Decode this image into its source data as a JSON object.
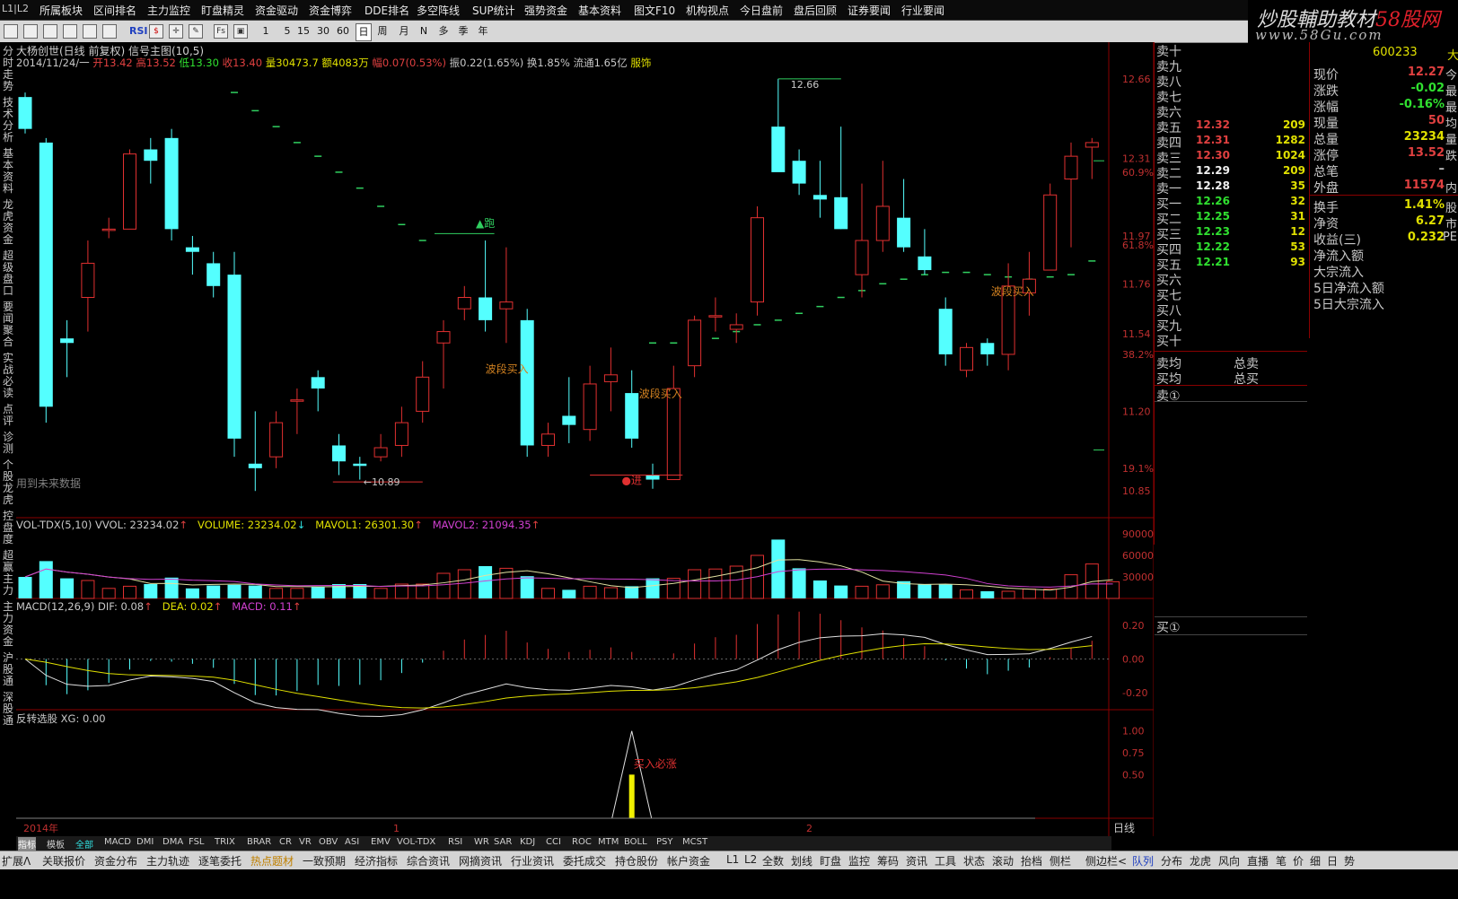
{
  "menu": {
    "l2": "L1|L2",
    "items": [
      "所属板块",
      "区间排名",
      "主力监控",
      "盯盘精灵",
      "资金驱动",
      "资金博弈",
      "DDE排名",
      "多空阵线",
      "SUP统计",
      "强势资金",
      "基本资料",
      "图文F10",
      "机构视点",
      "今日盘前",
      "盘后回顾",
      "证券要闻",
      "行业要闻"
    ]
  },
  "watermark": {
    "line1_a": "炒股輔助教材",
    "line1_b": "58股网",
    "line2": "www.58Gu.com"
  },
  "toolbar": {
    "items": [
      "RSI",
      "1",
      "5",
      "15",
      "30",
      "60",
      "日",
      "周",
      "月",
      "N",
      "多",
      "季",
      "年"
    ]
  },
  "left_tabs": [
    "分时走势",
    "技术分析",
    "基本资料",
    "龙虎资金",
    "超级盘口",
    "要闻聚合",
    "实战必读",
    "点评",
    "诊测",
    "个股龙虎",
    "控盘度",
    "超赢主力",
    "主力资金",
    "沪股通",
    "深股通"
  ],
  "chart_header": {
    "title": "大杨创世(日线 前复权) 信号主图(10,5)",
    "date": "2014/11/24/一",
    "open": "开13.42",
    "high": "高13.52",
    "low": "低13.30",
    "close": "收13.40",
    "vol": "量30473.7",
    "amount": "额4083万",
    "change": "幅0.07(0.53%)",
    "amp": "振0.22(1.65%)",
    "turnover": "换1.85%",
    "float": "流通1.65亿",
    "industry": "服饰"
  },
  "annotations": {
    "high": "12.66",
    "low": "10.89",
    "pao": "▲跑",
    "jin": "●进",
    "b1": "波段买入",
    "b2": "波段买入",
    "b3": "波段买入",
    "future": "用到未来数据",
    "buy_sure": "买入必涨"
  },
  "price_axis": {
    "labels": [
      "12.66",
      "12.31",
      "11.97",
      "11.76",
      "11.54",
      "11.20",
      "10.85"
    ],
    "pcts": [
      "60.9%",
      "61.8%",
      "38.2%",
      "19.1%"
    ]
  },
  "vol_header": {
    "name": "VOL-TDX(5,10)",
    "vvol": "VVOL: 23234.02",
    "volume": "VOLUME: 23234.02",
    "mavol1": "MAVOL1: 26301.30",
    "mavol2": "MAVOL2: 21094.35",
    "axis": [
      "90000",
      "60000",
      "30000"
    ]
  },
  "macd_header": {
    "name": "MACD(12,26,9)",
    "dif": "DIF: 0.08",
    "dea": "DEA: 0.02",
    "macd": "MACD: 0.11",
    "axis": [
      "0.20",
      "0.00",
      "-0.20"
    ]
  },
  "xg_header": {
    "name": "反转选股",
    "xg": "XG: 0.00",
    "axis": [
      "1.00",
      "0.75",
      "0.50"
    ]
  },
  "x_axis": {
    "year": "2014年",
    "m1": "1",
    "m2": "2",
    "period": "日线"
  },
  "chart_data": {
    "type": "candlestick",
    "ohlc": [
      [
        12.58,
        12.6,
        12.42,
        12.44
      ],
      [
        12.38,
        12.4,
        11.15,
        11.22
      ],
      [
        11.52,
        11.6,
        11.35,
        11.5
      ],
      [
        11.7,
        11.95,
        11.55,
        11.85
      ],
      [
        12.0,
        12.05,
        11.96,
        12.0
      ],
      [
        12.0,
        12.35,
        12.0,
        12.33
      ],
      [
        12.35,
        12.4,
        12.2,
        12.3
      ],
      [
        12.4,
        12.44,
        11.95,
        12.0
      ],
      [
        11.92,
        11.97,
        11.8,
        11.9
      ],
      [
        11.85,
        11.9,
        11.7,
        11.75
      ],
      [
        11.8,
        11.9,
        11.0,
        11.08
      ],
      [
        10.97,
        11.2,
        10.85,
        10.95
      ],
      [
        11.0,
        11.2,
        10.95,
        11.15
      ],
      [
        11.25,
        11.3,
        11.1,
        11.25
      ],
      [
        11.35,
        11.38,
        11.2,
        11.3
      ],
      [
        11.05,
        11.1,
        10.92,
        10.98
      ],
      [
        10.97,
        11.0,
        10.9,
        10.96
      ],
      [
        11.0,
        11.1,
        10.98,
        11.04
      ],
      [
        11.05,
        11.22,
        11.0,
        11.15
      ],
      [
        11.2,
        11.42,
        11.15,
        11.35
      ],
      [
        11.5,
        11.6,
        11.3,
        11.55
      ],
      [
        11.65,
        11.75,
        11.6,
        11.7
      ],
      [
        11.7,
        11.95,
        11.55,
        11.6
      ],
      [
        11.65,
        11.92,
        11.5,
        11.68
      ],
      [
        11.6,
        11.65,
        11.0,
        11.05
      ],
      [
        11.05,
        11.15,
        11.0,
        11.1
      ],
      [
        11.18,
        11.35,
        11.06,
        11.14
      ],
      [
        11.12,
        11.4,
        11.07,
        11.32
      ],
      [
        11.33,
        11.48,
        11.2,
        11.36
      ],
      [
        11.28,
        11.38,
        11.04,
        11.08
      ],
      [
        10.92,
        10.97,
        10.86,
        10.9
      ],
      [
        10.9,
        11.4,
        10.9,
        11.3
      ],
      [
        11.4,
        11.62,
        11.35,
        11.6
      ],
      [
        11.62,
        11.7,
        11.55,
        11.62
      ],
      [
        11.56,
        11.63,
        11.5,
        11.58
      ],
      [
        11.68,
        12.1,
        11.62,
        12.05
      ],
      [
        12.45,
        12.66,
        12.35,
        12.25
      ],
      [
        12.3,
        12.35,
        12.15,
        12.2
      ],
      [
        12.15,
        12.3,
        12.05,
        12.13
      ],
      [
        12.14,
        12.45,
        12.0,
        12.0
      ],
      [
        11.8,
        12.2,
        11.7,
        11.95
      ],
      [
        11.95,
        12.3,
        11.9,
        12.1
      ],
      [
        12.05,
        12.22,
        11.9,
        11.92
      ],
      [
        11.88,
        12.0,
        11.8,
        11.82
      ],
      [
        11.65,
        11.7,
        11.4,
        11.45
      ],
      [
        11.38,
        11.5,
        11.35,
        11.48
      ],
      [
        11.5,
        11.52,
        11.4,
        11.45
      ],
      [
        11.45,
        11.85,
        11.38,
        11.75
      ],
      [
        11.72,
        11.9,
        11.62,
        11.78
      ],
      [
        11.82,
        12.2,
        11.82,
        12.15
      ],
      [
        12.22,
        12.38,
        11.92,
        12.32
      ],
      [
        12.36,
        12.4,
        12.22,
        12.38
      ]
    ],
    "volume": [
      30000,
      52000,
      28000,
      25000,
      14000,
      17000,
      20000,
      29000,
      14000,
      18000,
      19000,
      18000,
      14000,
      14000,
      16000,
      20000,
      20000,
      14000,
      20000,
      20000,
      35000,
      40000,
      45000,
      42000,
      31000,
      14000,
      12000,
      17000,
      15000,
      17000,
      28000,
      28000,
      40000,
      41000,
      45000,
      60000,
      82000,
      42000,
      25000,
      18000,
      17000,
      19000,
      24000,
      20000,
      20000,
      12000,
      10000,
      10000,
      13000,
      13000,
      33000,
      48000,
      23234
    ],
    "mavol1_last": 26301.3,
    "mavol2_last": 21094.35
  },
  "orderbook": {
    "sell": [
      {
        "lbl": "卖十",
        "p": "",
        "v": ""
      },
      {
        "lbl": "卖九",
        "p": "",
        "v": ""
      },
      {
        "lbl": "卖八",
        "p": "",
        "v": ""
      },
      {
        "lbl": "卖七",
        "p": "",
        "v": ""
      },
      {
        "lbl": "卖六",
        "p": "",
        "v": ""
      },
      {
        "lbl": "卖五",
        "p": "12.32",
        "v": "209"
      },
      {
        "lbl": "卖四",
        "p": "12.31",
        "v": "1282"
      },
      {
        "lbl": "卖三",
        "p": "12.30",
        "v": "1024"
      },
      {
        "lbl": "卖二",
        "p": "12.29",
        "v": "209"
      },
      {
        "lbl": "卖一",
        "p": "12.28",
        "v": "35"
      }
    ],
    "buy": [
      {
        "lbl": "买一",
        "p": "12.26",
        "v": "32"
      },
      {
        "lbl": "买二",
        "p": "12.25",
        "v": "31"
      },
      {
        "lbl": "买三",
        "p": "12.23",
        "v": "12"
      },
      {
        "lbl": "买四",
        "p": "12.22",
        "v": "53"
      },
      {
        "lbl": "买五",
        "p": "12.21",
        "v": "93"
      },
      {
        "lbl": "买六",
        "p": "",
        "v": ""
      },
      {
        "lbl": "买七",
        "p": "",
        "v": ""
      },
      {
        "lbl": "买八",
        "p": "",
        "v": ""
      },
      {
        "lbl": "买九",
        "p": "",
        "v": ""
      },
      {
        "lbl": "买十",
        "p": "",
        "v": ""
      }
    ],
    "sell_avg": "卖均",
    "buy_avg": "买均",
    "total_sell": "总卖",
    "total_buy": "总买",
    "sell1_queue": "卖①",
    "buy1_queue": "买①"
  },
  "quote": {
    "code": "600233",
    "code_suffix": "大",
    "rows": [
      {
        "lbl": "现价",
        "val": "12.27",
        "suf": "今",
        "col": "#e04040"
      },
      {
        "lbl": "涨跌",
        "val": "-0.02",
        "suf": "最",
        "col": "#30e030"
      },
      {
        "lbl": "涨幅",
        "val": "-0.16%",
        "suf": "最",
        "col": "#30e030"
      },
      {
        "lbl": "现量",
        "val": "50",
        "suf": "均",
        "col": "#e04040"
      },
      {
        "lbl": "总量",
        "val": "23234",
        "suf": "量",
        "col": "#e0e000"
      },
      {
        "lbl": "涨停",
        "val": "13.52",
        "suf": "跌",
        "col": "#e04040"
      },
      {
        "lbl": "总笔",
        "val": "–",
        "suf": "",
        "col": "#c8c8c8"
      },
      {
        "lbl": "外盘",
        "val": "11574",
        "suf": "内",
        "col": "#e04040"
      },
      {
        "lbl": "换手",
        "val": "1.41%",
        "suf": "股",
        "col": "#e0e000"
      },
      {
        "lbl": "净资",
        "val": "6.27",
        "suf": "市",
        "col": "#e0e000"
      },
      {
        "lbl": "收益(三)",
        "val": "0.232",
        "suf": "PE",
        "col": "#e0e000"
      },
      {
        "lbl": "净流入额",
        "val": "",
        "suf": "",
        "col": "#e04040"
      },
      {
        "lbl": "大宗流入",
        "val": "",
        "suf": "",
        "col": "#e04040"
      },
      {
        "lbl": "5日净流入额",
        "val": "",
        "suf": "",
        "col": "#e04040"
      },
      {
        "lbl": "5日大宗流入",
        "val": "",
        "suf": "",
        "col": "#e04040"
      }
    ]
  },
  "indicator_tabs": [
    "指标",
    "模板",
    "全部",
    "MACD",
    "DMI",
    "DMA",
    "FSL",
    "TRIX",
    "BRAR",
    "CR",
    "VR",
    "OBV",
    "ASI",
    "EMV",
    "VOL-TDX",
    "RSI",
    "WR",
    "SAR",
    "KDJ",
    "CCI",
    "ROC",
    "MTM",
    "BOLL",
    "PSY",
    "MCST"
  ],
  "status_bar": [
    "扩展Λ",
    "关联报价",
    "资金分布",
    "主力轨迹",
    "逐笔委托",
    "热点题材",
    "一致预期",
    "经济指标",
    "综合资讯",
    "网摘资讯",
    "行业资讯",
    "委托成交",
    "持仓股份",
    "帐户资金",
    "L1",
    "L2",
    "全数",
    "划线",
    "盯盘",
    "监控",
    "筹码",
    "资讯",
    "工具",
    "状态",
    "滚动",
    "抬档",
    "侧栏",
    "侧边栏<",
    "队列",
    "分布",
    "龙虎",
    "风向",
    "直播",
    "笔",
    "价",
    "细",
    "日",
    "势"
  ],
  "colors": {
    "up": "#e03030",
    "down": "#54ffff",
    "bg": "#000000",
    "border": "#8a0000"
  }
}
